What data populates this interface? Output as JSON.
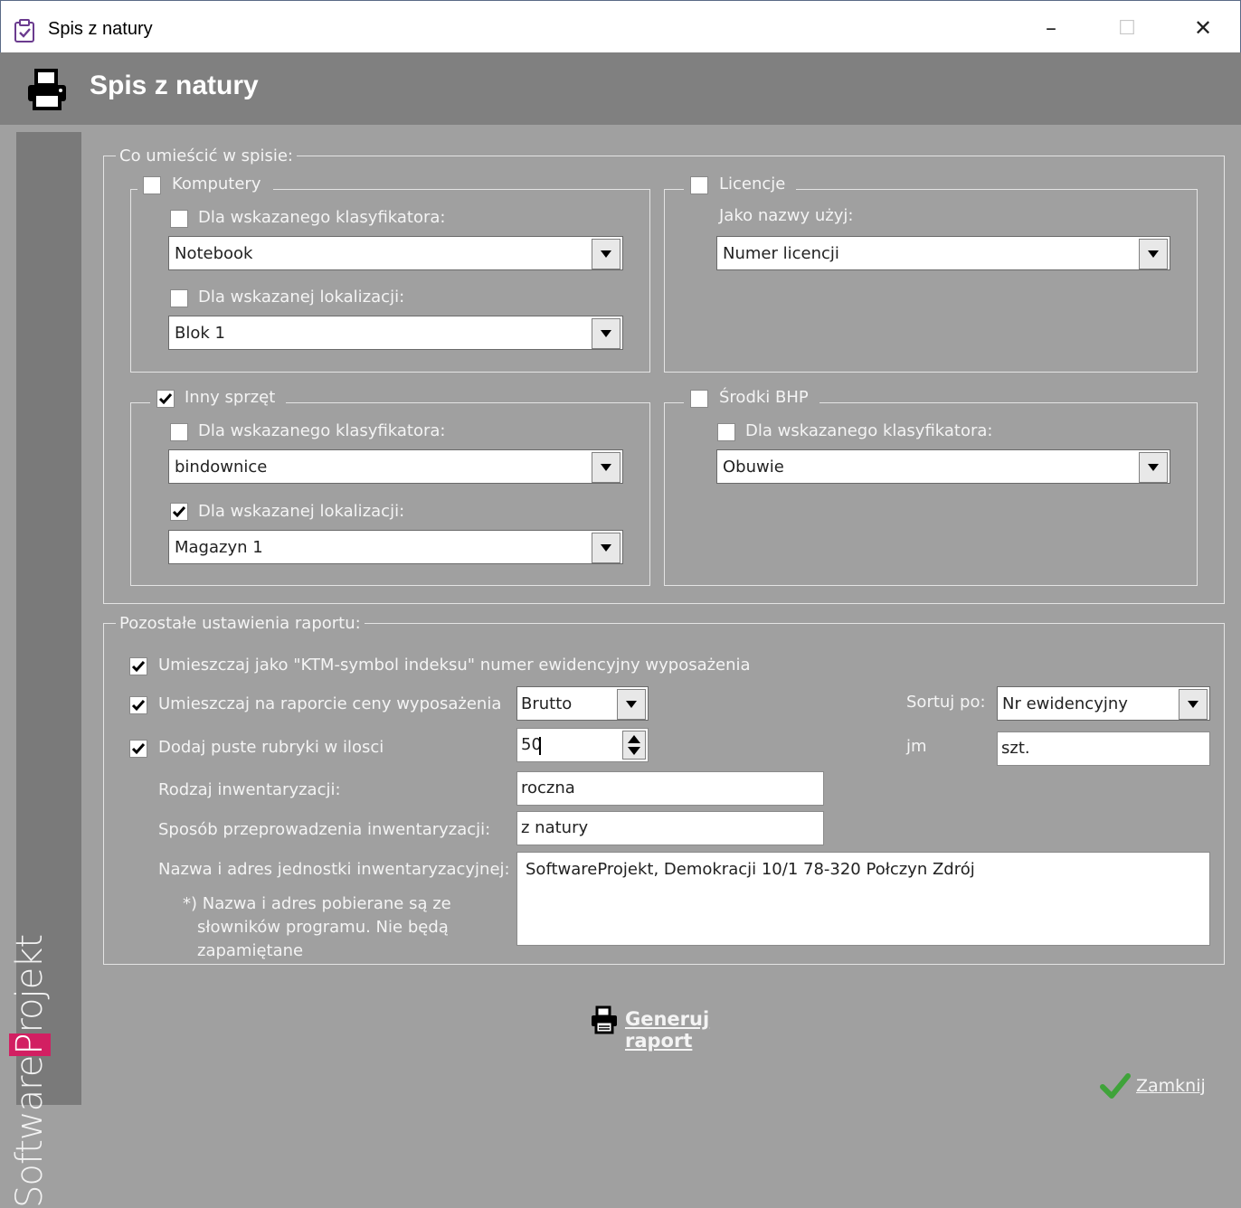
{
  "window": {
    "title": "Spis z natury",
    "controls": {
      "minimize": "–",
      "maximize": "☐",
      "close": "✕"
    }
  },
  "header": {
    "title": "Spis z natury"
  },
  "brand": {
    "prefix": "Software",
    "highlight": "P",
    "suffix": "rojekt"
  },
  "section1": {
    "legend": "Co umieścić w spisie:",
    "computers": {
      "label": "Komputery",
      "checked": false,
      "classifier": {
        "label": "Dla wskazanego klasyfikatora:",
        "checked": false,
        "value": "Notebook"
      },
      "location": {
        "label": "Dla wskazanej lokalizacji:",
        "checked": false,
        "value": "Blok 1"
      }
    },
    "licenses": {
      "label": "Licencje",
      "checked": false,
      "name_label": "Jako nazwy użyj:",
      "name_value": "Numer licencji"
    },
    "other": {
      "label": "Inny sprzęt",
      "checked": true,
      "classifier": {
        "label": "Dla wskazanego klasyfikatora:",
        "checked": false,
        "value": "bindownice"
      },
      "location": {
        "label": "Dla wskazanej lokalizacji:",
        "checked": true,
        "value": "Magazyn 1"
      }
    },
    "bhp": {
      "label": "Środki BHP",
      "checked": false,
      "classifier": {
        "label": "Dla wskazanego klasyfikatora:",
        "checked": false,
        "value": "Obuwie"
      }
    }
  },
  "section2": {
    "legend": "Pozostałe ustawienia raportu:",
    "ktm": {
      "label": "Umieszczaj jako \"KTM-symbol indeksu\" numer ewidencyjny wyposażenia",
      "checked": true
    },
    "prices": {
      "label": "Umieszczaj na raporcie ceny wyposażenia",
      "checked": true,
      "value": "Brutto"
    },
    "sort": {
      "label": "Sortuj po:",
      "value": "Nr ewidencyjny"
    },
    "empty_rows": {
      "label": "Dodaj puste rubryki w ilosci",
      "checked": true,
      "value": "50"
    },
    "unit": {
      "label": "jm",
      "value": "szt."
    },
    "inv_type": {
      "label": "Rodzaj inwentaryzacji:",
      "value": "roczna"
    },
    "inv_method": {
      "label": "Sposób przeprowadzenia inwentaryzacji:",
      "value": "z natury"
    },
    "unit_name": {
      "label": "Nazwa i adres jednostki inwentaryzacyjnej:",
      "value": "SoftwareProjekt, Demokracji  10/1 78-320 Połczyn Zdrój"
    },
    "note": [
      "*) Nazwa i adres pobierane są ze",
      "słowników programu. Nie będą",
      "zapamiętane"
    ]
  },
  "actions": {
    "generate": "Generuj raport",
    "close": "Zamknij"
  },
  "colors": {
    "background": "#a0a0a0",
    "header": "#808080",
    "sidebar": "#7a7a7a",
    "brand_accent": "#d21f62",
    "ok_green": "#3fa33a"
  }
}
